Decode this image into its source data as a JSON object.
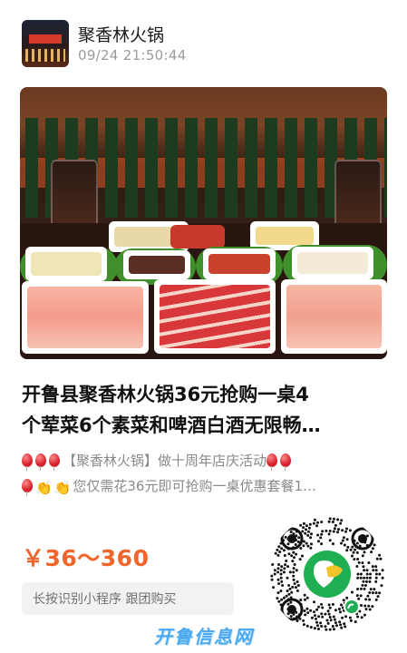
{
  "header": {
    "shop_name": "聚香林火锅",
    "timestamp": "09/24 21:50:44",
    "avatar_sign": "聚香林火锅"
  },
  "title": {
    "line1": "开鲁县聚香林火锅36元抢购一桌4",
    "line2": "个荤菜6个素菜和啤酒白酒无限畅…"
  },
  "description": {
    "line1_text": "【聚香林火锅】做十周年店庆活动",
    "line2_text": "您仅需花36元即可抢购一桌优惠套餐1…"
  },
  "price": "￥36～360",
  "action_hint": "长按识别小程序  跟团购买",
  "watermark": "开鲁信息网",
  "colors": {
    "price": "#f0652b",
    "watermark": "#4aa9f0",
    "mini_program_green": "#1fae52"
  },
  "icons": {
    "balloon": "red-balloon-icon",
    "clap": "clapping-hands-icon",
    "qr": "mini-program-code-icon"
  }
}
